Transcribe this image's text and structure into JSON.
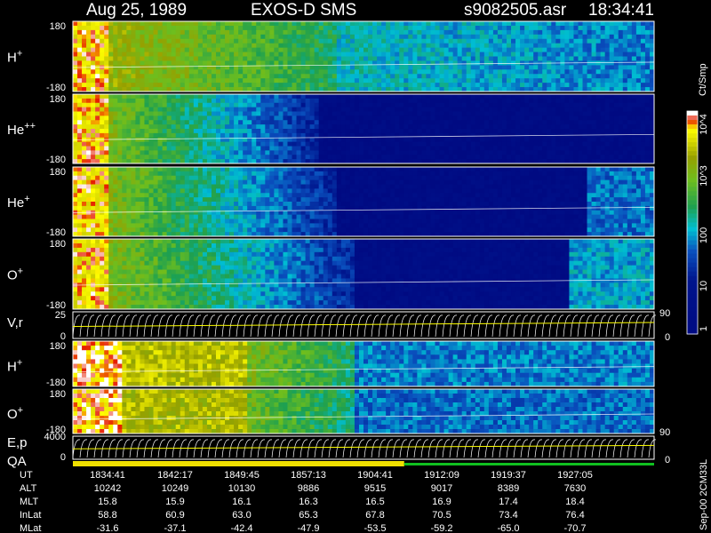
{
  "header": {
    "date": "Aug 25, 1989",
    "instrument": "EXOS-D SMS",
    "file": "s9082505.asr",
    "time": "18:34:41"
  },
  "chart_data": {
    "type": "heatmap",
    "panels": [
      {
        "label": "H+",
        "base": "H",
        "sup": "+",
        "ylim": [
          -180,
          180
        ],
        "top_tick": "180",
        "bottom_tick": "-180"
      },
      {
        "label": "He++",
        "base": "He",
        "sup": "++",
        "ylim": [
          -180,
          180
        ],
        "top_tick": "180",
        "bottom_tick": "-180"
      },
      {
        "label": "He+",
        "base": "He",
        "sup": "+",
        "ylim": [
          -180,
          180
        ],
        "top_tick": "180",
        "bottom_tick": "-180"
      },
      {
        "label": "O+",
        "base": "O",
        "sup": "+",
        "ylim": [
          -180,
          180
        ],
        "top_tick": "180",
        "bottom_tick": "-180"
      }
    ],
    "vr_panel": {
      "label": "V,r",
      "left_ticks": [
        "25",
        "0"
      ],
      "right_ticks": [
        "90",
        "0"
      ]
    },
    "lower_panels": [
      {
        "label": "H+",
        "base": "H",
        "sup": "+",
        "top_tick": "180",
        "bottom_tick": "-180"
      },
      {
        "label": "O+",
        "base": "O",
        "sup": "+",
        "top_tick": "180",
        "bottom_tick": "-180"
      }
    ],
    "ep_panel": {
      "label_top": "E,p",
      "label_bottom": "QA",
      "left_ticks": [
        "4000",
        "0"
      ],
      "right_ticks": [
        "90",
        "0"
      ]
    },
    "colorbar": {
      "title": "Ct/Smp",
      "ticks": [
        "10^4",
        "10^3",
        "100",
        "10",
        "1"
      ],
      "scale": "log",
      "range": [
        1,
        10000
      ]
    },
    "colors": {
      "background": "#000000",
      "frame": "#ffffff",
      "low": "#00148a",
      "high": "#ffff00",
      "qa_yellow": "#f0e000",
      "qa_green": "#10c020"
    },
    "ephemeris": {
      "row_labels": [
        "UT",
        "ALT",
        "MLT",
        "InLat",
        "MLat"
      ],
      "columns": [
        [
          "1834:41",
          "10242",
          "15.8",
          "58.8",
          "-31.6"
        ],
        [
          "1842:17",
          "10249",
          "15.9",
          "60.9",
          "-37.1"
        ],
        [
          "1849:45",
          "10130",
          "16.1",
          "63.0",
          "-42.4"
        ],
        [
          "1857:13",
          "9886",
          "16.3",
          "65.3",
          "-47.9"
        ],
        [
          "1904:41",
          "9515",
          "16.5",
          "67.8",
          "-53.5"
        ],
        [
          "1912:09",
          "9017",
          "16.9",
          "70.5",
          "-59.2"
        ],
        [
          "1919:37",
          "8389",
          "17.4",
          "73.4",
          "-65.0"
        ],
        [
          "1927:05",
          "7630",
          "18.4",
          "76.4",
          "-70.7"
        ]
      ]
    },
    "footer": "Sep-00 2CM33L"
  }
}
